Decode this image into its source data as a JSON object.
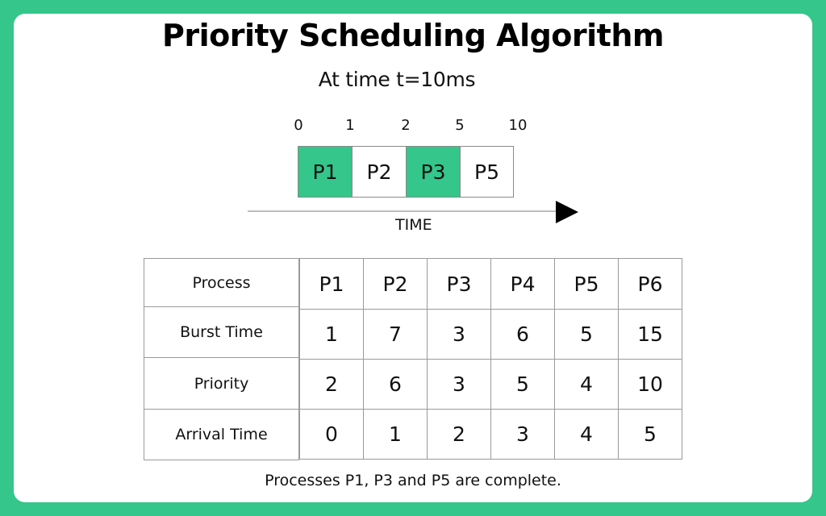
{
  "title": "Priority Scheduling Algorithm",
  "subtitle": "At time t=10ms",
  "colors": {
    "background": "#34c68a",
    "completed_block": "#34c68a",
    "pending_block": "#ffffff",
    "card": "#ffffff"
  },
  "gantt": {
    "ticks": [
      "0",
      "1",
      "2",
      "5",
      "10"
    ],
    "blocks": [
      {
        "label": "P1",
        "start": 0,
        "end": 1,
        "state": "done"
      },
      {
        "label": "P2",
        "start": 1,
        "end": 2,
        "state": "pending"
      },
      {
        "label": "P3",
        "start": 2,
        "end": 5,
        "state": "done"
      },
      {
        "label": "P5",
        "start": 5,
        "end": 10,
        "state": "pending"
      }
    ],
    "axis_label": "TIME",
    "arrow_icon": "right-triangle-arrow"
  },
  "table": {
    "row_labels": [
      "Process",
      "Burst Time",
      "Priority",
      "Arrival Time"
    ],
    "columns": [
      {
        "process": "P1",
        "burst": "1",
        "priority": "2",
        "arrival": "0"
      },
      {
        "process": "P2",
        "burst": "7",
        "priority": "6",
        "arrival": "1"
      },
      {
        "process": "P3",
        "burst": "3",
        "priority": "3",
        "arrival": "2"
      },
      {
        "process": "P4",
        "burst": "6",
        "priority": "5",
        "arrival": "3"
      },
      {
        "process": "P5",
        "burst": "5",
        "priority": "4",
        "arrival": "4"
      },
      {
        "process": "P6",
        "burst": "15",
        "priority": "10",
        "arrival": "5"
      }
    ]
  },
  "footer": "Processes P1, P3 and P5 are complete."
}
